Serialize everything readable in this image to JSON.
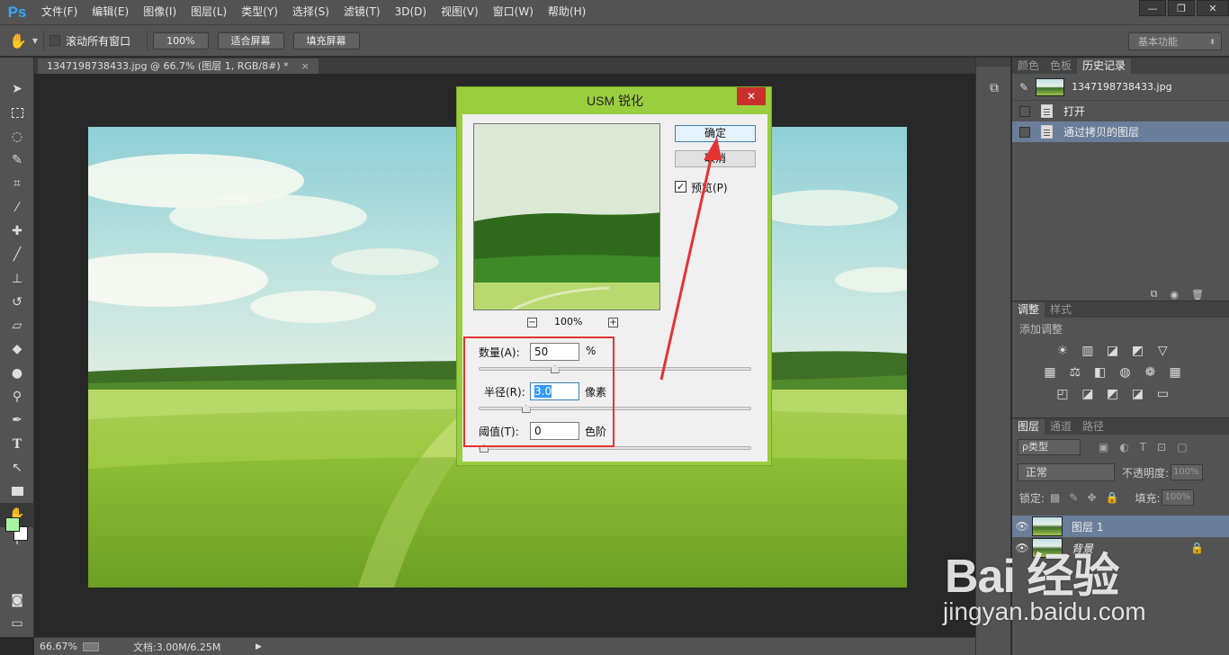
{
  "app": {
    "logo": "Ps",
    "menu": [
      "文件(F)",
      "编辑(E)",
      "图像(I)",
      "图层(L)",
      "类型(Y)",
      "选择(S)",
      "滤镜(T)",
      "3D(D)",
      "视图(V)",
      "窗口(W)",
      "帮助(H)"
    ],
    "window_controls": {
      "minimize": "—",
      "restore": "❐",
      "close": "✕"
    }
  },
  "options_bar": {
    "scroll_all_windows": "滚动所有窗口",
    "zoom_100": "100%",
    "fit_screen": "适合屏幕",
    "fill_screen": "填充屏幕",
    "workspace": "基本功能"
  },
  "document": {
    "tab_title": "1347198738433.jpg @ 66.7% (图层 1, RGB/8#) *",
    "tab_close": "×"
  },
  "status": {
    "zoom": "66.67%",
    "doc_size": "文档:3.00M/6.25M"
  },
  "history_panel": {
    "tabs": [
      "颜色",
      "色板",
      "历史记录"
    ],
    "active_tab": 2,
    "snapshot_name": "1347198738433.jpg",
    "items": [
      "打开",
      "通过拷贝的图层"
    ],
    "selected_index": 1
  },
  "adjustments_panel": {
    "tabs": [
      "调整",
      "样式"
    ],
    "title": "添加调整"
  },
  "layers_panel": {
    "tabs": [
      "图层",
      "通道",
      "路径"
    ],
    "filter": "ρ类型",
    "blend_mode": "正常",
    "opacity_label": "不透明度:",
    "opacity_value": "100%",
    "lock_label": "锁定:",
    "fill_label": "填充:",
    "fill_value": "100%",
    "layers": [
      {
        "name": "图层 1",
        "selected": true
      },
      {
        "name": "背景",
        "selected": false
      }
    ]
  },
  "dialog": {
    "title": "USM 锐化",
    "close": "✕",
    "ok": "确定",
    "cancel": "取消",
    "preview_label": "预览(P)",
    "preview_checked": true,
    "zoom": "100%",
    "amount_label": "数量(A):",
    "amount_value": "50",
    "amount_unit": "%",
    "amount_fraction": 0.27,
    "radius_label": "半径(R):",
    "radius_value": "3.0",
    "radius_unit": "像素",
    "radius_fraction": 0.16,
    "threshold_label": "阈值(T):",
    "threshold_value": "0",
    "threshold_unit": "色阶",
    "threshold_fraction": 0.0
  },
  "watermark": {
    "brand": "Bai 经验",
    "url": "jingyan.baidu.com"
  }
}
